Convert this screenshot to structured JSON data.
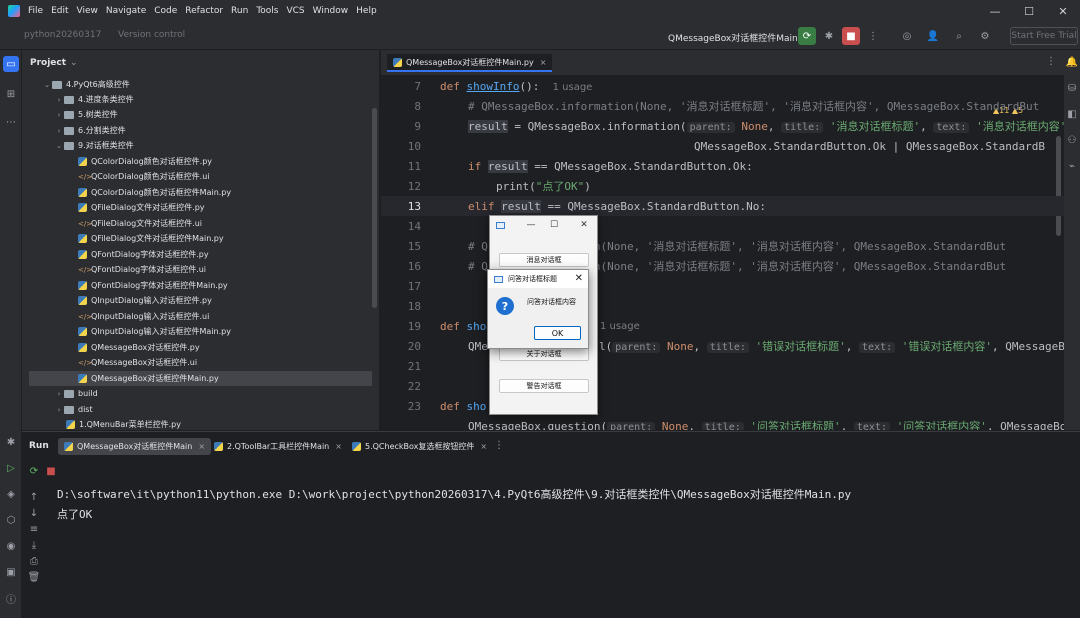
{
  "menu": [
    "File",
    "Edit",
    "View",
    "Navigate",
    "Code",
    "Refactor",
    "Run",
    "Tools",
    "VCS",
    "Window",
    "Help"
  ],
  "toolbar": {
    "project_widget": "python20260317",
    "vcs_widget": "Version control",
    "run_config": "QMessageBox对话框控件Main",
    "start_free_trial": "Start Free Trial"
  },
  "project_panel": {
    "title": "Project",
    "tree": [
      {
        "label": "4.PyQt6高级控件",
        "type": "folder",
        "expanded": true
      },
      {
        "label": "4.进度条类控件",
        "type": "folder"
      },
      {
        "label": "5.树类控件",
        "type": "folder"
      },
      {
        "label": "6.分割类控件",
        "type": "folder"
      },
      {
        "label": "9.对话框类控件",
        "type": "folder",
        "expanded": true
      },
      {
        "label": "QColorDialog颜色对话框控件.py",
        "type": "py"
      },
      {
        "label": "QColorDialog颜色对话框控件.ui",
        "type": "ui"
      },
      {
        "label": "QColorDialog颜色对话框控件Main.py",
        "type": "py"
      },
      {
        "label": "QFileDialog文件对话框控件.py",
        "type": "py"
      },
      {
        "label": "QFileDialog文件对话框控件.ui",
        "type": "ui"
      },
      {
        "label": "QFileDialog文件对话框控件Main.py",
        "type": "py"
      },
      {
        "label": "QFontDialog字体对话框控件.py",
        "type": "py"
      },
      {
        "label": "QFontDialog字体对话框控件.ui",
        "type": "ui"
      },
      {
        "label": "QFontDialog字体对话框控件Main.py",
        "type": "py"
      },
      {
        "label": "QInputDialog输入对话框控件.py",
        "type": "py"
      },
      {
        "label": "QInputDialog输入对话框控件.ui",
        "type": "ui"
      },
      {
        "label": "QInputDialog输入对话框控件Main.py",
        "type": "py"
      },
      {
        "label": "QMessageBox对话框控件.py",
        "type": "py"
      },
      {
        "label": "QMessageBox对话框控件.ui",
        "type": "ui"
      },
      {
        "label": "QMessageBox对话框控件Main.py",
        "type": "py",
        "selected": true
      },
      {
        "label": "build",
        "type": "folder"
      },
      {
        "label": "dist",
        "type": "folder"
      },
      {
        "label": "1.QMenuBar菜单栏控件.py",
        "type": "py"
      }
    ]
  },
  "editor": {
    "tab": "QMessageBox对话框控件Main.py",
    "warnings": "▲11 ▲5",
    "line_numbers": [
      "7",
      "8",
      "9",
      "10",
      "11",
      "12",
      "13",
      "14",
      "15",
      "16",
      "17",
      "18",
      "19",
      "20",
      "21",
      "22",
      "23"
    ],
    "usage1": "1 usage",
    "usage2": "1 usage",
    "lines": {
      "l7_def": "def ",
      "l7_fn": "showInfo",
      "l7_rest": "():",
      "l8": "# QMessageBox.information(None, '消息对话框标题', '消息对话框内容', QMessageBox.StandardBut",
      "l9_a": "result",
      "l9_b": " = QMessageBox.information(",
      "l9_h1": "parent:",
      "l9_v1": " None",
      "l9_c1": ", ",
      "l9_h2": "title:",
      "l9_v2": " '消息对话框标题'",
      "l9_c2": ", ",
      "l9_h3": "text:",
      "l9_v3": " '消息对话框内容'",
      "l9_c3": ",",
      "l10": "QMessageBox.StandardButton.Ok | QMessageBox.StandardB",
      "l11_kw": "if ",
      "l11_v": "result",
      "l11_rest": " == QMessageBox.StandardButton.Ok:",
      "l12_fn": "print(",
      "l12_str": "\"点了OK\"",
      "l12_end": ")",
      "l13_kw": "elif ",
      "l13_v": "result",
      "l13_rest": " == QMessageBox.StandardButton.No:",
      "l15": "# Q           mation(None, '消息对话框标题', '消息对话框内容', QMessageBox.StandardBut",
      "l16": "# Q           mation(None, '消息对话框标题', '消息对话框内容', QMessageBox.StandardBut",
      "l19_kw": "def ",
      "l19_fn": "sho",
      "l20_a": "QMe",
      "l20_b": "l(",
      "l20_h1": "parent:",
      "l20_v1": " None",
      "l20_h2": "title:",
      "l20_v2": " '错误对话框标题'",
      "l20_h3": "text:",
      "l20_v3": " '错误对话框内容'",
      "l20_end": ", QMessageBox.S",
      "l23_kw": "def ",
      "l23_fn": "sho",
      "l24": "QMessageBox.question(",
      "l24_h1": "parent:",
      "l24_v1": " None",
      "l24_h2": "title:",
      "l24_v2": " '问答对话框标题'",
      "l24_h3": "text:",
      "l24_v3": " '问答对话框内容'",
      "l24_end": ", QMessageBox.S"
    }
  },
  "run_panel": {
    "label": "Run",
    "tabs": [
      "QMessageBox对话框控件Main",
      "2.QToolBar工具栏控件Main",
      "5.QCheckBox复选框按钮控件"
    ],
    "console": [
      "D:\\software\\it\\python11\\python.exe D:\\work\\project\\python20260317\\4.PyQt6高级控件\\9.对话框类控件\\QMessageBox对话框控件Main.py",
      "点了OK"
    ]
  },
  "qt_main_window": {
    "buttons": [
      "消息对话框",
      "关于对话框",
      "警告对话框"
    ]
  },
  "msgbox": {
    "title": "问答对话框标题",
    "text": "问答对话框内容",
    "ok": "OK"
  },
  "colors": {
    "accent": "#3574f0",
    "keyword": "#cf8e6d",
    "function": "#56a8f5",
    "string": "#6aab73",
    "comment": "#7a7e85"
  }
}
